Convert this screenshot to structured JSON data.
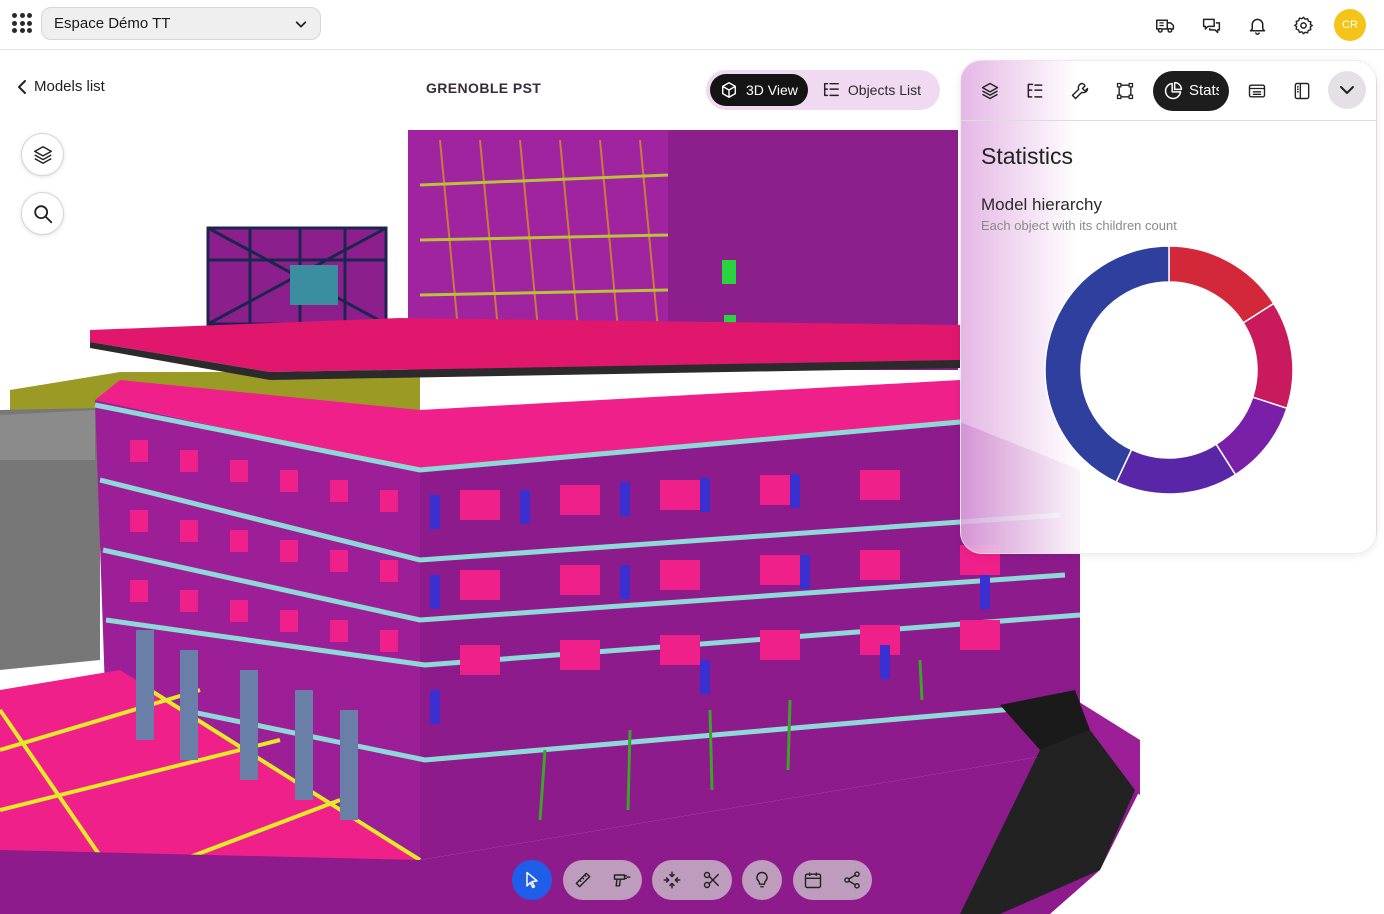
{
  "topbar": {
    "space_name": "Espace Démo TT",
    "avatar_initials": "CR",
    "icons": [
      "apps-grid-icon",
      "chevron-down-icon",
      "truck-icon",
      "chat-icon",
      "bell-icon",
      "gear-icon"
    ]
  },
  "subheader": {
    "back_label": "Models list",
    "model_title": "GRENOBLE PST",
    "view_3d_label": "3D View",
    "objects_list_label": "Objects List"
  },
  "left_tools": [
    "layers-icon",
    "search-icon"
  ],
  "panel": {
    "toolbar_icons": [
      "layers-icon",
      "tree-icon",
      "wrench-icon",
      "bounding-box-icon",
      "statistics-icon",
      "window-icon",
      "split-view-icon",
      "chevron-down-icon"
    ],
    "stats_tab_label": "Stats",
    "title": "Statistics",
    "section_title": "Model hierarchy",
    "section_subtitle": "Each object with its children count",
    "accent_color": "#1d1d1d"
  },
  "chart_data": {
    "type": "pie",
    "variant": "donut",
    "title": "",
    "series": [
      {
        "values": [
          0.16,
          0.14,
          0.11,
          0.16,
          0.43
        ],
        "colors": [
          "#d2283a",
          "#c81a5c",
          "#7a1fa8",
          "#5a26a8",
          "#2e3f9e"
        ]
      }
    ],
    "legend": "none"
  },
  "bottom_toolbar": {
    "groups": [
      [
        "select-cursor-icon"
      ],
      [
        "ruler-icon",
        "drill-icon"
      ],
      [
        "explode-icon",
        "scissors-icon"
      ],
      [
        "lightbulb-icon"
      ],
      [
        "calendar-icon",
        "share-icon"
      ]
    ],
    "active": "select-cursor-icon",
    "active_color": "#1e5ee8"
  }
}
